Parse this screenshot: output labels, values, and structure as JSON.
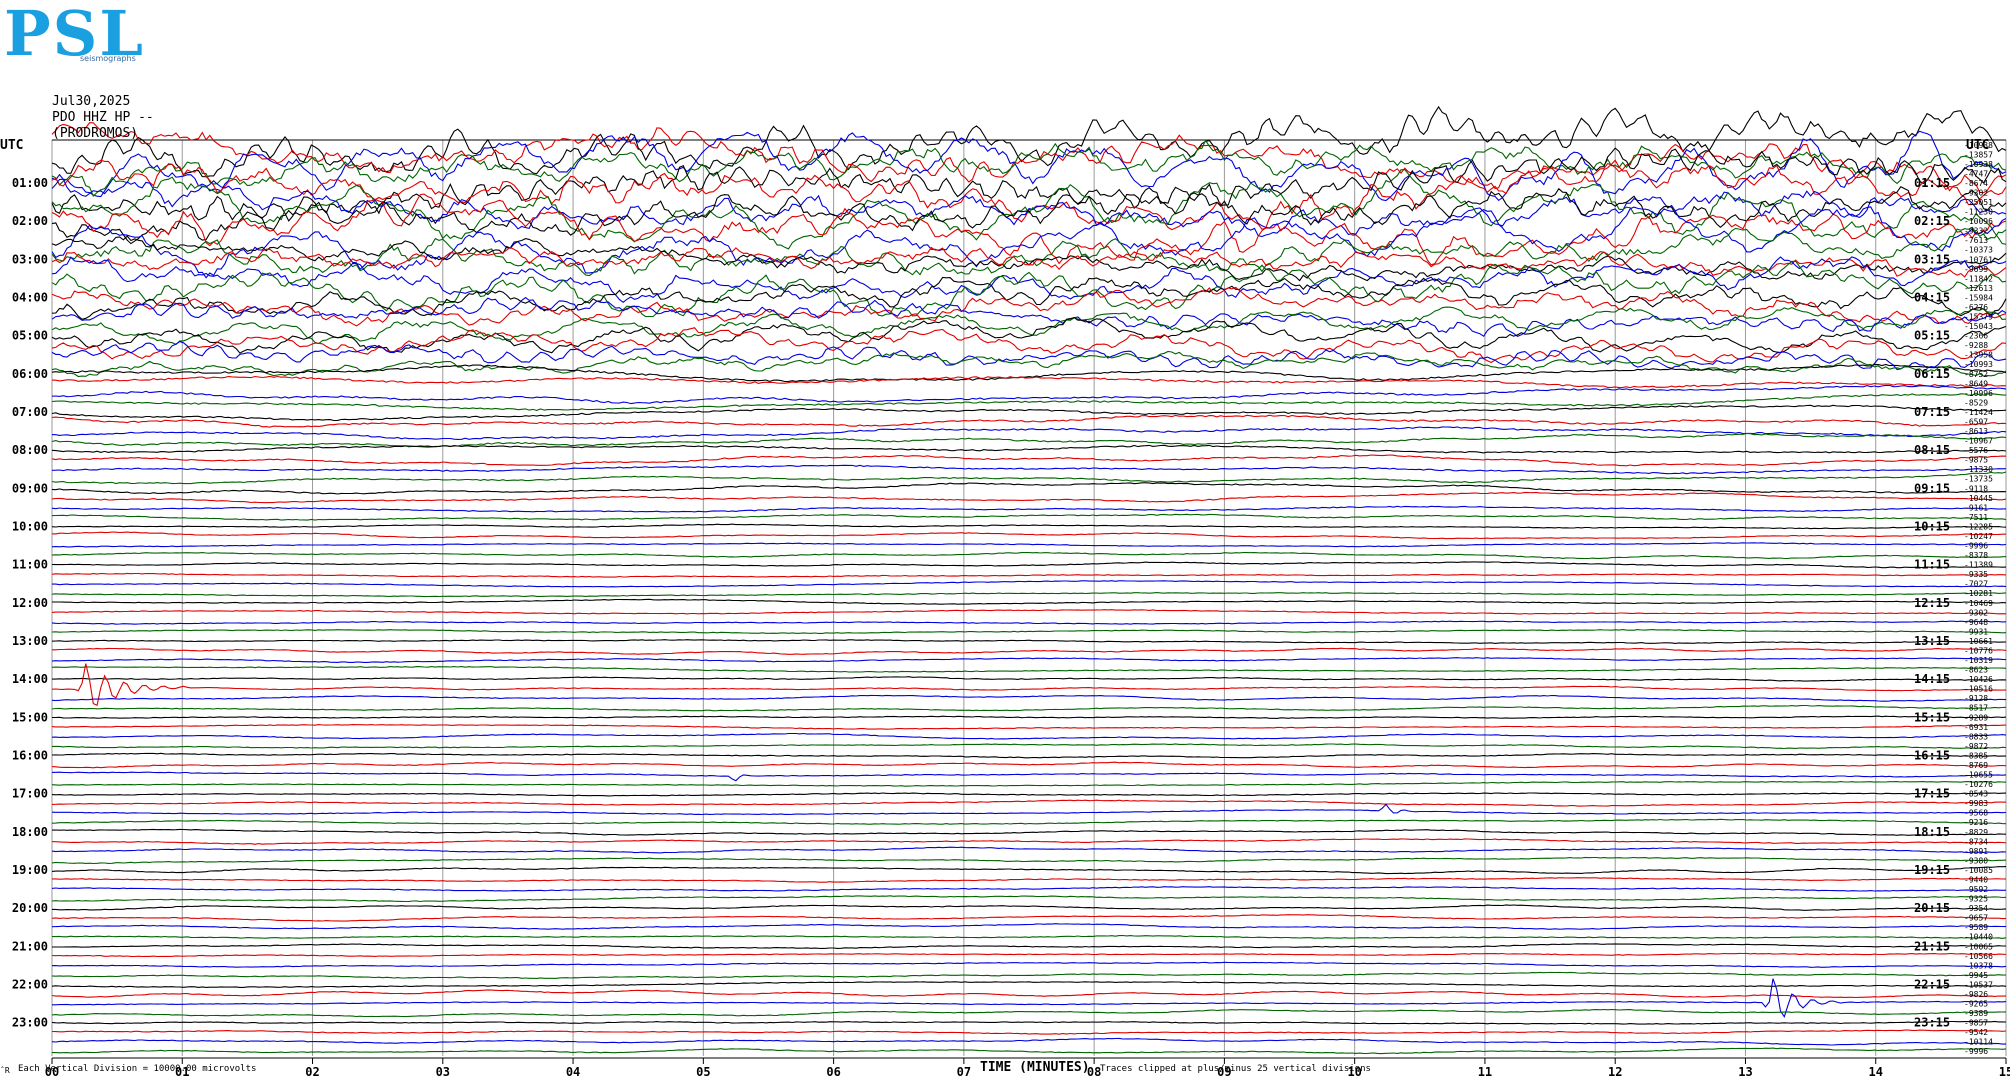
{
  "header": {
    "logo_text": "PSL",
    "logo_subtext": "seismographs",
    "date": "Jul30,2025",
    "station": "PDO HHZ HP --",
    "network": "(PRODROMOS)"
  },
  "axes": {
    "utc_left_label": "UTC",
    "utc_right_label": "UTC",
    "x_title": "TIME (MINUTES)",
    "footer_left": "Each Vertical Division = 10000.00 microvolts",
    "footer_right": "Traces clipped at plus/minus 25 vertical divisions",
    "footer_mark": "ˆR"
  },
  "colors": {
    "cycle": [
      "#000000",
      "#e00000",
      "#0000e0",
      "#006400"
    ],
    "grid": "#9a9a9a"
  },
  "chart_data": {
    "type": "line",
    "title": "",
    "xlabel": "TIME (MINUTES)",
    "ylabel": "",
    "xlim": [
      0,
      15
    ],
    "x_ticks": [
      "00",
      "01",
      "02",
      "03",
      "04",
      "05",
      "06",
      "07",
      "08",
      "09",
      "10",
      "11",
      "12",
      "13",
      "14",
      "15"
    ],
    "grid": "vertical",
    "row_count": 96,
    "left_hour_labels": [
      "01:00",
      "02:00",
      "03:00",
      "04:00",
      "05:00",
      "06:00",
      "07:00",
      "08:00",
      "09:00",
      "10:00",
      "11:00",
      "12:00",
      "13:00",
      "14:00",
      "15:00",
      "16:00",
      "17:00",
      "18:00",
      "19:00",
      "20:00",
      "21:00",
      "22:00",
      "23:00"
    ],
    "right_hour_labels": [
      "01:15",
      "02:15",
      "03:15",
      "04:15",
      "05:15",
      "06:15",
      "07:15",
      "08:15",
      "09:15",
      "10:15",
      "11:15",
      "12:15",
      "13:15",
      "14:15",
      "15:15",
      "16:15",
      "17:15",
      "18:15",
      "19:15",
      "20:15",
      "21:15",
      "22:15",
      "23:15"
    ],
    "offsets": [
      "-10938",
      "-13857",
      "-10938",
      "-4747",
      "-8674",
      "-9302",
      "-25051",
      "-11230",
      "-10096",
      "-9332",
      "-7613",
      "-10373",
      "-10761",
      "-9699",
      "-11842",
      "-12613",
      "-15984",
      "-6276",
      "-15379",
      "-15043",
      "-2366",
      "-9288",
      "-13958",
      "-10993",
      "-8752",
      "-8649",
      "-10996",
      "-8529",
      "-11424",
      "-6597",
      "-8613",
      "-10967",
      "-5576",
      "-9875",
      "-11330",
      "-13735",
      "-9118",
      "-10445",
      "-9161",
      "-7511",
      "-12285",
      "-10247",
      "-9996",
      "-8378",
      "-11389",
      "-9335",
      "-7027",
      "-10281",
      "-10469",
      "-9302",
      "-9648",
      "-9931",
      "-10661",
      "-10776",
      "-10319",
      "-8623",
      "-10426",
      "-10516",
      "-9128",
      "-8517",
      "-9289",
      "-6931",
      "-8833",
      "-9872",
      "-8385",
      "-8769",
      "-10655",
      "-10276",
      "-8543",
      "-9983",
      "-9568",
      "-9216",
      "-8829",
      "-8734",
      "-9891",
      "-9380",
      "-10085",
      "-9440",
      "-9592",
      "-9325",
      "-9354",
      "-9657",
      "-9589",
      "-10440",
      "-10065",
      "-10566",
      "-10378",
      "-9945",
      "-10537",
      "-9826",
      "-9265",
      "-9389",
      "-9857",
      "-9542",
      "-10114",
      "-9996"
    ],
    "events": [
      {
        "row": 57,
        "x_min": 0.2,
        "duration": 0.9,
        "amp": 1.6
      },
      {
        "row": 66,
        "x_min": 5.2,
        "duration": 0.2,
        "amp": 0.6
      },
      {
        "row": 70,
        "x_min": 10.2,
        "duration": 0.3,
        "amp": 0.5
      },
      {
        "row": 90,
        "x_min": 13.15,
        "duration": 0.6,
        "amp": 1.8
      }
    ]
  }
}
